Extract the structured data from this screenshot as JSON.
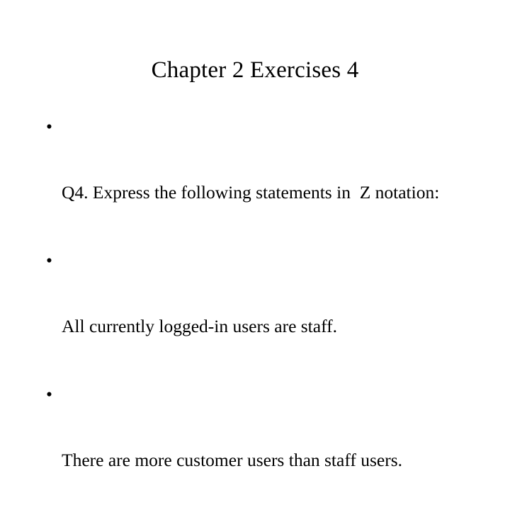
{
  "slide": {
    "title": "Chapter 2 Exercises 4",
    "bullet_marker": "•",
    "bullets": [
      {
        "text": "Q4. Express the following statements in  Z notation:"
      },
      {
        "text": "All currently logged-in users are staff."
      },
      {
        "text": "There are more customer users than staff users."
      }
    ]
  },
  "colors": {
    "background": "#ffffff",
    "text": "#000000"
  }
}
